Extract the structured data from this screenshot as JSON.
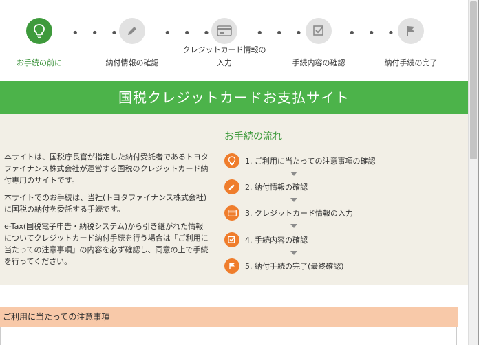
{
  "stepper": {
    "steps": [
      {
        "label": "お手続の前に",
        "icon": "lightbulb-icon",
        "active": true
      },
      {
        "label": "納付情報の確認",
        "icon": "pencil-icon",
        "active": false
      },
      {
        "label_line1": "クレジットカード情報の",
        "label_line2": "入力",
        "icon": "credit-card-icon",
        "active": false
      },
      {
        "label": "手続内容の確認",
        "icon": "checkbox-icon",
        "active": false
      },
      {
        "label": "納付手続の完了",
        "icon": "flag-icon",
        "active": false
      }
    ],
    "separator": "• • •"
  },
  "banner": {
    "title": "国税クレジットカードお支払サイト"
  },
  "intro": {
    "paragraphs": [
      "本サイトは、国税庁長官が指定した納付受託者であるトヨタファイナンス株式会社が運営する国税のクレジットカード納付専用のサイトです。",
      "本サイトでのお手続は、当社(トヨタファイナンス株式会社)に国税の納付を委託する手続です。",
      "e-Tax(国税電子申告・納税システム)から引き継がれた情報についてクレジットカード納付手続を行う場合は「ご利用に当たっての注意事項」の内容を必ず確認し、同意の上で手続を行ってください。"
    ]
  },
  "flow": {
    "title": "お手続の流れ",
    "items": [
      {
        "text": "1. ご利用に当たっての注意事項の確認",
        "icon": "lightbulb-icon"
      },
      {
        "text": "2. 納付情報の確認",
        "icon": "pencil-icon"
      },
      {
        "text": "3. クレジットカード情報の入力",
        "icon": "credit-card-icon"
      },
      {
        "text": "4. 手続内容の確認",
        "icon": "checkbox-icon"
      },
      {
        "text": "5. 納付手続の完了(最終確認)",
        "icon": "flag-icon"
      }
    ]
  },
  "notes": {
    "header": "ご利用に当たっての注意事項"
  },
  "colors": {
    "accent_green": "#4cb34a",
    "active_green": "#3e9a3c",
    "flow_orange": "#ef7d2c",
    "notes_header_bg": "#f8c9a9",
    "main_bg": "#f2efe6"
  }
}
